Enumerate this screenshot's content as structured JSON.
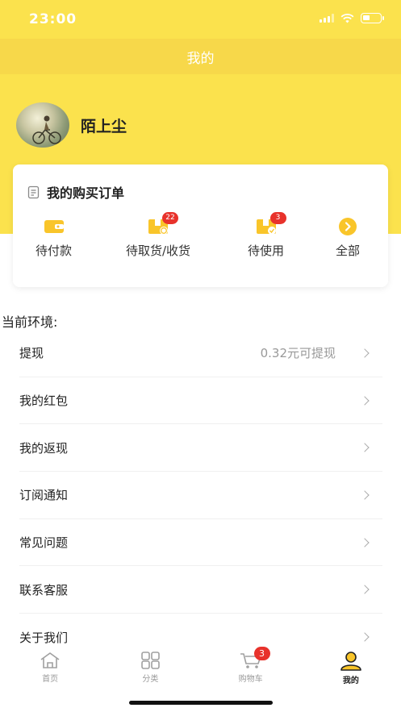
{
  "status_bar": {
    "time": "23:00"
  },
  "nav": {
    "title": "我的"
  },
  "profile": {
    "username": "陌上尘"
  },
  "orders": {
    "title": "我的购买订单",
    "items": [
      {
        "label": "待付款",
        "icon": "wallet-icon",
        "badge": ""
      },
      {
        "label": "待取货/收货",
        "icon": "package-pickup-icon",
        "badge": "22"
      },
      {
        "label": "待使用",
        "icon": "package-use-icon",
        "badge": "3"
      },
      {
        "label": "全部",
        "icon": "arrow-right-circle-icon",
        "badge": ""
      }
    ]
  },
  "environment": {
    "label": "当前环境:"
  },
  "menu": [
    {
      "label": "提现",
      "value": "0.32元可提现"
    },
    {
      "label": "我的红包",
      "value": ""
    },
    {
      "label": "我的返现",
      "value": ""
    },
    {
      "label": "订阅通知",
      "value": ""
    },
    {
      "label": "常见问题",
      "value": ""
    },
    {
      "label": "联系客服",
      "value": ""
    },
    {
      "label": "关于我们",
      "value": ""
    }
  ],
  "tabs": [
    {
      "label": "首页",
      "icon": "home-icon"
    },
    {
      "label": "分类",
      "icon": "grid-icon"
    },
    {
      "label": "购物车",
      "icon": "cart-icon",
      "badge": "3"
    },
    {
      "label": "我的",
      "icon": "user-icon",
      "active": true
    }
  ],
  "colors": {
    "accent": "#fbe24d",
    "icon_yellow": "#f9c52a",
    "badge_red": "#e8322b"
  }
}
